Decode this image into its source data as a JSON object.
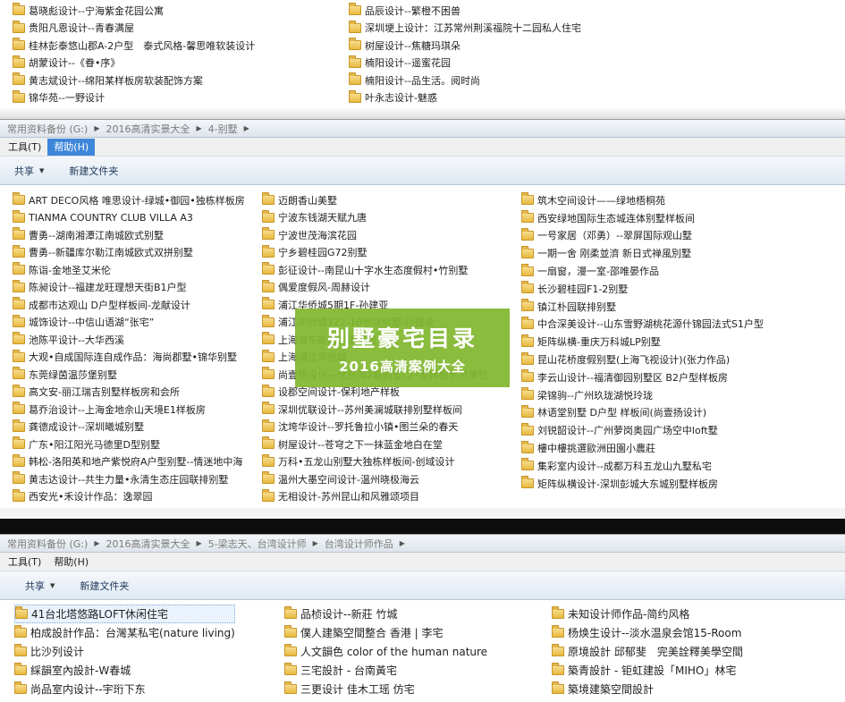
{
  "panel1": {
    "col1": [
      "葛晓彪设计--宁海紫金花园公寓",
      "贵阳凡恩设计--青春满屋",
      "桂林彭泰悠山郡A-2户型　泰式风格-馨思唯软装设计",
      "胡蒙设计--《眷•序》",
      "黄志斌设计--绵阳某样板房软装配饰方案",
      "锦华苑--一野设计"
    ],
    "col2": [
      "品辰设计--繁橙不困兽",
      "深圳埂上设计：江苏常州荆溪福院十二园私人住宅",
      "树屋设计--焦糖玛琪朵",
      "楠阳设计--遥蜜花园",
      "楠阳设计--品生活。阅时尚",
      "叶永志设计-魅惑"
    ]
  },
  "panel2": {
    "breadcrumb": [
      "常用资料备份 (G:)",
      "2016高清实景大全",
      "4-别墅"
    ],
    "menu": [
      "工具(T)",
      "帮助(H)"
    ],
    "commands": {
      "share": "共享",
      "new_folder": "新建文件夹"
    },
    "col1": [
      "ART DECO风格 唯思设计-绿城•御园•独栋样板房",
      "TIANMA COUNTRY CLUB VILLA A3",
      "曹勇--湖南湘潭江南城欧式别墅",
      "曹勇--新疆库尔勒江南城欧式双拼别墅",
      "陈诣-金地圣艾米伦",
      "陈昶设计--福建龙旺理想天街B1户型",
      "成都市达观山 D户型样板间-龙献设计",
      "城饰设计--中信山语湖“张宅”",
      "池陈平设计--大华西溪",
      "大观•自成国际连自成作品：海尚郡墅•锦华别墅",
      "东莞绿茵温莎堡别墅",
      "高文安-丽江瑞吉别墅样板房和会所",
      "葛乔治设计--上海金地佘山天境E1样板房",
      "龚德成设计--深圳曦城别墅",
      "广东•阳江阳光马德里D型别墅",
      "韩松-洛阳英和地产紫悦府A户型别墅--情迷地中海",
      "黄志达设计--共生力量•永清生态庄园联排别墅",
      "西安光•禾设计作品：逸翠园"
    ],
    "col2": [
      "迈朗香山美墅",
      "宁波东钱湖天赋九唐",
      "宁波世茂海滨花园",
      "宁乡碧桂园G72别墅",
      "彭征设计--南昆山十字水生态度假村•竹别墅",
      "偶爱度假风-周赫设计",
      "浦江华侨城5期1F-孙建亚",
      "浦江华侨城122-10地块别墅-孙建亚",
      "上海浦东新区四季雅苑",
      "上海浦江华侨城",
      "尚壹扬设计—北京湾2期别墅C户型样板示范单位",
      "设郡空间设计-保利地产样板",
      "深圳优联设计--苏州美澜城联排别墅样板间",
      "沈垮华设计--罗托鲁拉小镇•图兰朵的春天",
      "树屋设计--苍穹之下一抹蓝金地白在堂",
      "万科•五龙山别墅大独栋样板间-创域设计",
      "温州大墨空间设计-温州晓极海云",
      "无相设计-苏州昆山和风雅颂项目"
    ],
    "col3": [
      "筑木空间设计——绿地梧桐苑",
      "西安绿地国际生态城连体别墅样板间",
      "一号家居（邓勇）--翠屏国际观山墅",
      "一期一舍 刚柔並濟 新日式禅風別墅",
      "一扇窗，漫一室-邵唯晏作品",
      "长沙碧桂园F1-2别墅",
      "镇江朴园联排别墅",
      "中合深美设计--山东雪野湖桃花源什锦园法式S1户型",
      "矩阵纵横-重庆万科城LP别墅",
      "昆山花桥度假别墅(上海飞视设计)(张力作品)",
      "李云山设计--福清御园别墅区 B2户型样板房",
      "梁锦驹--广州玖珑湖悦玲珑",
      "林语堂别墅 D户型 样板间(尚壹扬设计)",
      "刘锐韶设计--广州萝岗奥园广场空中loft墅",
      "樓中樓挑選歐洲田園小農莊",
      "集彩室内设计--成都万科五龙山九墅私宅",
      "矩阵纵横设计-深圳彭城大东城别墅样板房"
    ],
    "banner": {
      "line1": "别墅豪宅目录",
      "line2": "2016高清案例大全"
    }
  },
  "panel3": {
    "breadcrumb": [
      "常用资料备份 (G:)",
      "2016高清实景大全",
      "5-梁志天、台湾设计师",
      "台湾设计师作品"
    ],
    "menu": [
      "工具(T)",
      "帮助(H)"
    ],
    "commands": {
      "share": "共享",
      "new_folder": "新建文件夹"
    },
    "col1": [
      "41台北塔悠路LOFT休闲住宅",
      "柏成設計作品：台灣某私宅(nature living)",
      "比沙列设计",
      "綵韻室內設計-W春城",
      "尚品室内设计--宇珩下东"
    ],
    "col2": [
      "品桢设计--新莊 竹城",
      "僕人建築空間整合 香港 | 李宅",
      "人文韻色 color of the human nature",
      "三宅設計 - 台南黃宅",
      "三更设计 佳木工瑶 仿宅"
    ],
    "col3": [
      "未知设计师作品-简约风格",
      "杨焕生设计--淡水温泉会馆15-Room",
      "原境設計 邱郁斐　完美詮釋美學空間",
      "築青設計 - 钜虹建設「MIHO」林宅",
      "築境建築空間設計"
    ]
  },
  "colors": {
    "menu_active": "#3d86d9",
    "banner_green": "#81b72f",
    "folder": "#e8b93e"
  }
}
